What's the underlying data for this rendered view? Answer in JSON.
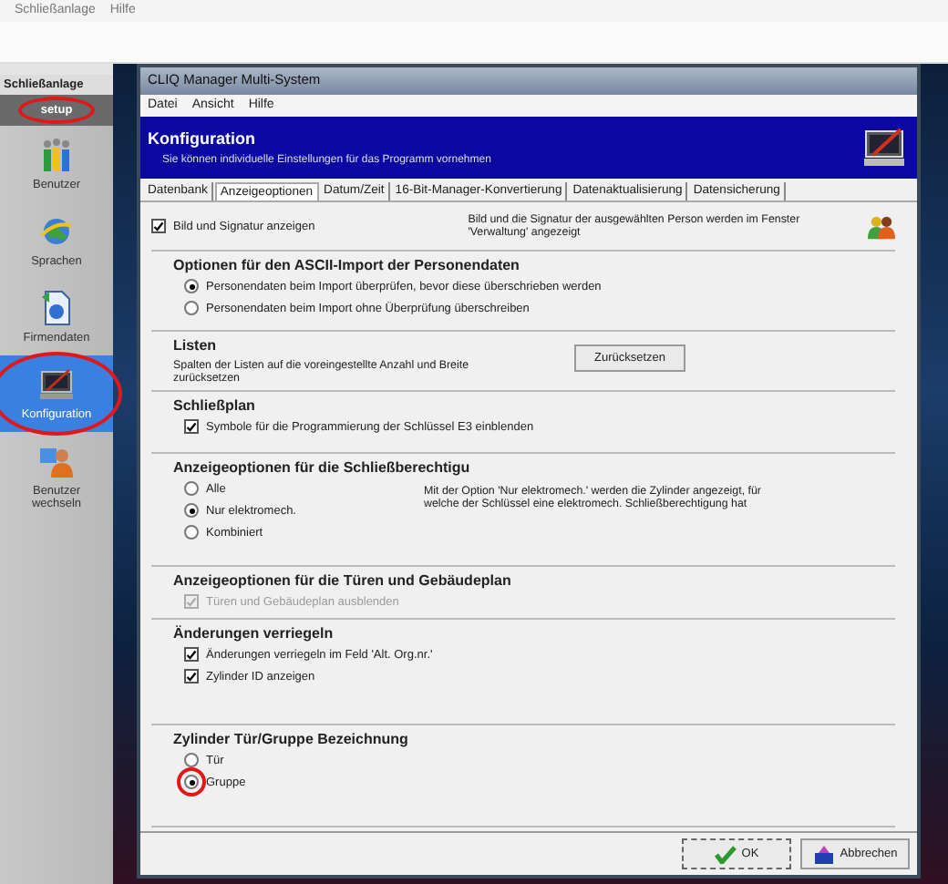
{
  "app_menu": [
    "Schließanlage",
    "Hilfe"
  ],
  "sidebar": {
    "header": "Schließanlage",
    "group": "setup",
    "items": [
      {
        "label": "Benutzer",
        "selected": false
      },
      {
        "label": "Sprachen",
        "selected": false
      },
      {
        "label": "Firmendaten",
        "selected": false
      },
      {
        "label": "Konfiguration",
        "selected": true
      },
      {
        "label": "Benutzer wechseln",
        "selected": false
      }
    ]
  },
  "window": {
    "title": "CLIQ Manager Multi-System",
    "menu": [
      "Datei",
      "Ansicht",
      "Hilfe"
    ],
    "header": {
      "title": "Konfiguration",
      "subtitle": "Sie können individuelle Einstellungen für das Programm vornehmen"
    },
    "tabs": [
      {
        "label": "Datenbank",
        "selected": false
      },
      {
        "label": "Anzeigeoptionen",
        "selected": true
      },
      {
        "label": "Datum/Zeit",
        "selected": false
      },
      {
        "label": "16-Bit-Manager-Konvertierung",
        "selected": false
      },
      {
        "label": "Datenaktualisierung",
        "selected": false
      },
      {
        "label": "Datensicherung",
        "selected": false
      }
    ],
    "top_option": {
      "label": "Bild und Signatur anzeigen",
      "checked": true,
      "note": "Bild und die Signatur der ausgewählten Person werden im Fenster 'Verwaltung' angezeigt"
    },
    "sections": [
      {
        "title": "Optionen für den ASCII-Import der Personendaten",
        "options": [
          {
            "kind": "radio",
            "label": "Personendaten beim Import überprüfen, bevor diese überschrieben werden",
            "selected": true,
            "disabled": false
          },
          {
            "kind": "radio",
            "label": "Personendaten beim Import ohne Überprüfung überschreiben",
            "selected": false,
            "disabled": false
          }
        ]
      },
      {
        "title": "Listen",
        "text": "Spalten der Listen auf die voreingestellte Anzahl und Breite zurücksetzen",
        "button": "Zurücksetzen"
      },
      {
        "title": "Schließplan",
        "options": [
          {
            "kind": "checkbox",
            "label": "Symbole für die Programmierung der Schlüssel E3 einblenden",
            "selected": true,
            "disabled": false
          }
        ]
      },
      {
        "title": "Anzeigeoptionen für die Schließberechtigu",
        "note": "Mit der Option 'Nur elektromech.' werden die Zylinder angezeigt, für welche der Schlüssel eine elektromech. Schließberechtigung hat",
        "options": [
          {
            "kind": "radio",
            "label": "Alle",
            "selected": false,
            "disabled": false
          },
          {
            "kind": "radio",
            "label": "Nur elektromech.",
            "selected": true,
            "disabled": false
          },
          {
            "kind": "radio",
            "label": "Kombiniert",
            "selected": false,
            "disabled": false
          }
        ]
      },
      {
        "title": "Anzeigeoptionen für die Türen und Gebäudeplan",
        "options": [
          {
            "kind": "checkbox",
            "label": "Türen und Gebäudeplan ausblenden",
            "selected": true,
            "disabled": true
          }
        ]
      },
      {
        "title": "Änderungen verriegeln",
        "options": [
          {
            "kind": "checkbox",
            "label": "Änderungen verriegeln im Feld 'Alt. Org.nr.'",
            "selected": true,
            "disabled": false
          },
          {
            "kind": "checkbox",
            "label": "Zylinder ID anzeigen",
            "selected": true,
            "disabled": false
          }
        ]
      },
      {
        "title": "Zylinder Tür/Gruppe Bezeichnung",
        "options": [
          {
            "kind": "radio",
            "label": "Tür",
            "selected": false,
            "disabled": false
          },
          {
            "kind": "radio",
            "label": "Gruppe",
            "selected": true,
            "disabled": false
          }
        ]
      }
    ],
    "buttons": [
      {
        "kind": "ok",
        "label": "OK"
      },
      {
        "kind": "cancel",
        "label": "Abbrechen"
      }
    ]
  }
}
